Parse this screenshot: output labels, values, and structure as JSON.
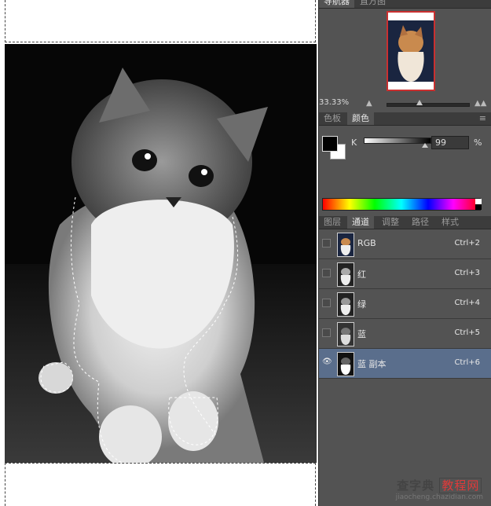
{
  "navigator": {
    "tabs": [
      "导航器",
      "直方图"
    ],
    "zoom": "33.33%",
    "zoom_slider_fraction": 0.33
  },
  "color_panel": {
    "tabs": [
      "色板",
      "颜色"
    ],
    "k_label": "K",
    "k_value": "99",
    "k_unit": "%",
    "foreground_color": "#000000",
    "background_color": "#ffffff"
  },
  "layers_panel": {
    "tabs": [
      "图层",
      "通道",
      "调整",
      "路径",
      "样式"
    ],
    "channels": [
      {
        "name": "RGB",
        "shortcut": "Ctrl+2",
        "visible": false,
        "selected": false
      },
      {
        "name": "红",
        "shortcut": "Ctrl+3",
        "visible": false,
        "selected": false
      },
      {
        "name": "绿",
        "shortcut": "Ctrl+4",
        "visible": false,
        "selected": false
      },
      {
        "name": "蓝",
        "shortcut": "Ctrl+5",
        "visible": false,
        "selected": false
      },
      {
        "name": "蓝 副本",
        "shortcut": "Ctrl+6",
        "visible": true,
        "selected": true
      }
    ]
  },
  "watermark": {
    "site_name": "查字典",
    "site_tag": "教程网",
    "url": "jiaocheng.chazidian.com"
  }
}
